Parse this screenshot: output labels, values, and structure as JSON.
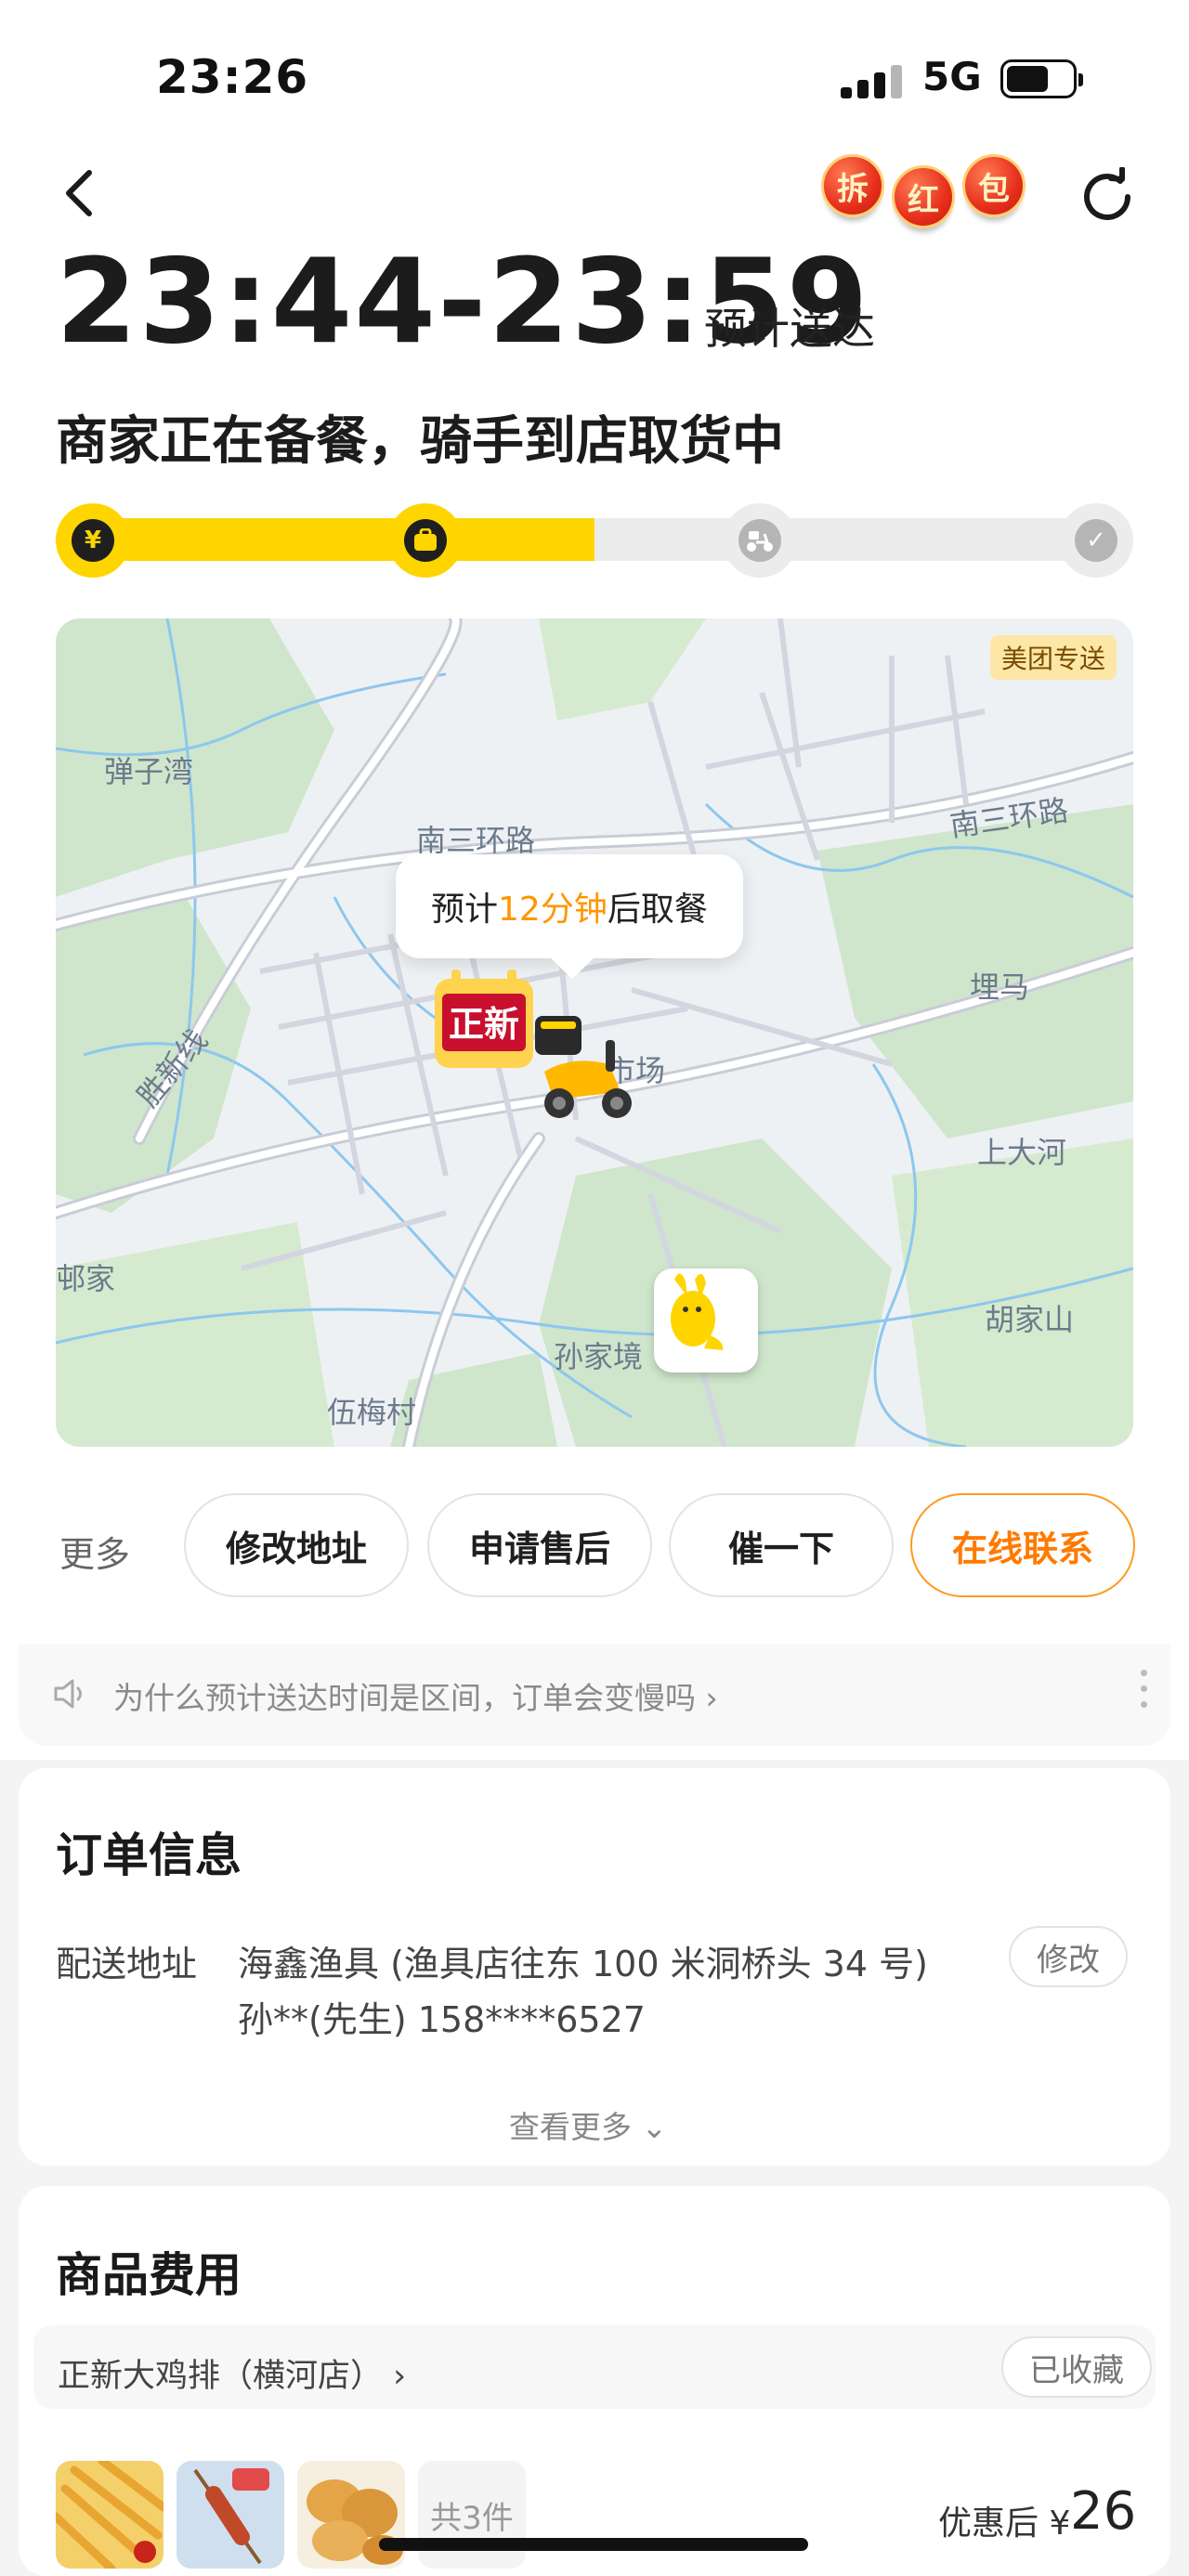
{
  "status_bar": {
    "time": "23:26",
    "network": "5G"
  },
  "header": {
    "redpack_chars": [
      "拆",
      "红",
      "包"
    ],
    "eta_time": "23:44-23:59",
    "eta_label": "预计送达",
    "status_title": "商家正在备餐，骑手到店取货中"
  },
  "progress": {
    "fill_fraction": 0.5,
    "steps": [
      {
        "name": "paid",
        "glyph": "¥",
        "active": true
      },
      {
        "name": "preparing",
        "glyph": "",
        "active": true
      },
      {
        "name": "delivering",
        "glyph": "",
        "active": false
      },
      {
        "name": "delivered",
        "glyph": "✓",
        "active": false
      }
    ]
  },
  "map": {
    "tag": "美团专送",
    "bubble_prefix": "预计",
    "bubble_highlight": "12分钟",
    "bubble_suffix": "后取餐",
    "store_badge": "正新",
    "labels": {
      "danziwan": "弹子湾",
      "nansanhuan1": "南三环路",
      "nansanhuan2": "南三环路",
      "shengxin": "胜新线",
      "shichang": "市场",
      "maima": "埋马",
      "shangdahe": "上大河",
      "qiujia": "邨家",
      "hujiashan": "胡家山",
      "sunjiajing": "孙家境",
      "wumeicun": "伍梅村"
    }
  },
  "actions": {
    "more": "更多",
    "buttons": [
      "修改地址",
      "申请售后",
      "催一下",
      "在线联系"
    ]
  },
  "notice": {
    "text": "为什么预计送达时间是区间，订单会变慢吗 ›"
  },
  "order_info": {
    "title": "订单信息",
    "address_label": "配送地址",
    "address_line1": "海鑫渔具 (渔具店往东 100 米洞桥头 34 号)",
    "address_line2": "孙**(先生) 158****6527",
    "edit_button": "修改",
    "see_more": "查看更多 ⌄"
  },
  "goods": {
    "title": "商品费用",
    "shop_name": "正新大鸡排（横河店） ›",
    "favorite": "已收藏",
    "count": "共3件",
    "price_label": "优惠后 ¥",
    "price_value": "26"
  }
}
